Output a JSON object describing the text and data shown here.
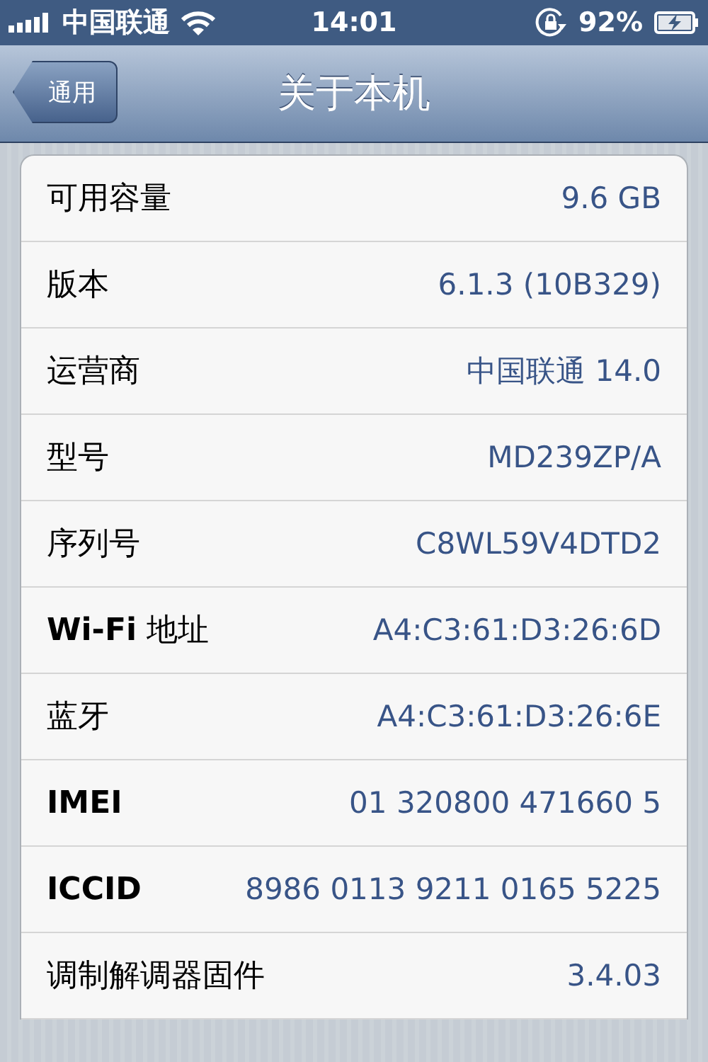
{
  "status_bar": {
    "carrier": "中国联通",
    "time": "14:01",
    "battery": "92%"
  },
  "nav_bar": {
    "back": "通用",
    "title": "关于本机"
  },
  "rows": [
    {
      "label": "可用容量",
      "value": "9.6 GB"
    },
    {
      "label": "版本",
      "value": "6.1.3 (10B329)"
    },
    {
      "label": "运营商",
      "value": "中国联通 14.0"
    },
    {
      "label": "型号",
      "value": "MD239ZP/A"
    },
    {
      "label": "序列号",
      "value": "C8WL59V4DTD2"
    },
    {
      "label": "**Wi-Fi** 地址",
      "value": "A4:C3:61:D3:26:6D"
    },
    {
      "label": "蓝牙",
      "value": "A4:C3:61:D3:26:6E"
    },
    {
      "label": "IMEI",
      "value": "01 320800 471660 5"
    },
    {
      "label": "ICCID",
      "value": "8986 0113 9211 0165 5225"
    },
    {
      "label": "调制解调器固件",
      "value": "3.4.03"
    }
  ]
}
